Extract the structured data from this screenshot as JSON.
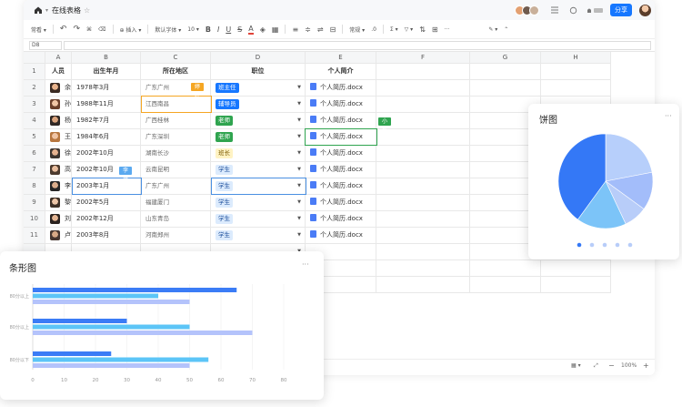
{
  "doc": {
    "title": "在线表格",
    "share_label": "分享",
    "star_glyph": "☆"
  },
  "toolbar": {
    "undo": "↶",
    "redo": "↷",
    "format_brush": "⌘",
    "clear": "⌫",
    "insert_label": "⊕ 插入 ▾",
    "view_label": "常看 ▾",
    "font_name": "默认字体 ▾",
    "font_size": "10 ▾",
    "bold": "B",
    "italic": "I",
    "underline": "U",
    "strike": "S",
    "fontcolor": "A",
    "fill": "◈",
    "border": "▦",
    "align_left": "≡",
    "valign": "≑",
    "wrap": "⇌",
    "merge": "⊟",
    "number_format": "常规 ▾",
    "decimal": ".0",
    "sum": "Σ ▾",
    "filter": "▽ ▾",
    "sort": "⇅",
    "freeze": "⊞",
    "more": "···",
    "paint": "✎ ▾",
    "collapse": "⌃"
  },
  "formula": {
    "cellref": "D8"
  },
  "columns": [
    "A",
    "B",
    "C",
    "D",
    "E",
    "F",
    "G",
    "H"
  ],
  "header_row": {
    "row": "1",
    "person": "人员",
    "birth": "出生年月",
    "region": "所在地区",
    "job": "职位",
    "resume": "个人简介"
  },
  "rows": [
    {
      "row": "2",
      "person": "余若云",
      "birth": "1978年3月",
      "region": "广东广州",
      "job": "班主任",
      "job_style": "blue",
      "resume": "个人简历.docx"
    },
    {
      "row": "3",
      "person": "孙婷婷",
      "birth": "1988年11月",
      "region": "江西南昌",
      "job": "辅导员",
      "job_style": "blue",
      "resume": "个人简历.docx"
    },
    {
      "row": "4",
      "person": "杨秀夏",
      "birth": "1982年7月",
      "region": "广西桂林",
      "job": "老师",
      "job_style": "green",
      "resume": "个人简历.docx"
    },
    {
      "row": "5",
      "person": "王小星",
      "birth": "1984年6月",
      "region": "广东深圳",
      "job": "老师",
      "job_style": "green",
      "resume": "个人简历.docx"
    },
    {
      "row": "6",
      "person": "徐建",
      "birth": "2002年10月",
      "region": "湖南长沙",
      "job": "班长",
      "job_style": "yellow",
      "resume": "个人简历.docx"
    },
    {
      "row": "7",
      "person": "高俊华",
      "birth": "2002年10月",
      "region": "云南昆明",
      "job": "学生",
      "job_style": "light",
      "resume": "个人简历.docx"
    },
    {
      "row": "8",
      "person": "李冬",
      "birth": "2003年1月",
      "region": "广东广州",
      "job": "学生",
      "job_style": "light",
      "resume": "个人简历.docx"
    },
    {
      "row": "9",
      "person": "黎晓志",
      "birth": "2002年5月",
      "region": "福建厦门",
      "job": "学生",
      "job_style": "light",
      "resume": "个人简历.docx"
    },
    {
      "row": "10",
      "person": "刘熠翔",
      "birth": "2002年12月",
      "region": "山东青岛",
      "job": "学生",
      "job_style": "light",
      "resume": "个人简历.docx"
    },
    {
      "row": "11",
      "person": "卢俊",
      "birth": "2003年8月",
      "region": "河南郑州",
      "job": "学生",
      "job_style": "light",
      "resume": "个人简历.docx"
    }
  ],
  "flags": {
    "orange": "婷婷",
    "blue": "李冬",
    "green": "小星"
  },
  "statusbar": {
    "zoom": "100%",
    "minus": "−",
    "plus": "+",
    "fit": "⤢",
    "view": "▦ ▾"
  },
  "pie_card": {
    "title": "饼图",
    "more": "···"
  },
  "bar_card": {
    "title": "条形图",
    "more": "···"
  },
  "colors": {
    "accent": "#1677ff",
    "tag_blue": "#1677ff",
    "tag_green": "#2fa44f",
    "tag_yellow": "#fff3c4",
    "tag_light": "#dcebfd",
    "select_orange": "#f5a623",
    "select_blue": "#4a90e2",
    "select_green": "#2fa44f"
  },
  "chart_data": [
    {
      "type": "pie",
      "title": "饼图",
      "values": [
        22,
        13,
        8,
        17,
        40
      ],
      "colors": [
        "#b7cffb",
        "#a3bdfa",
        "#b8cdf9",
        "#7cc4f8",
        "#3478f6"
      ],
      "pagination_dots": 5
    },
    {
      "type": "bar",
      "orientation": "horizontal",
      "title": "条形图",
      "categories": [
        "80分以上",
        "80分以上",
        "80分以下"
      ],
      "series": [
        {
          "values": [
            65,
            30,
            25
          ],
          "color": "#3b7cf6"
        },
        {
          "values": [
            40,
            50,
            56
          ],
          "color": "#5cc5f7"
        },
        {
          "values": [
            50,
            70,
            50
          ],
          "color": "#b4c3fb"
        }
      ],
      "xticks": [
        0,
        10,
        20,
        30,
        40,
        50,
        60,
        70,
        80
      ],
      "xlim": [
        0,
        80
      ],
      "grid": true
    }
  ]
}
